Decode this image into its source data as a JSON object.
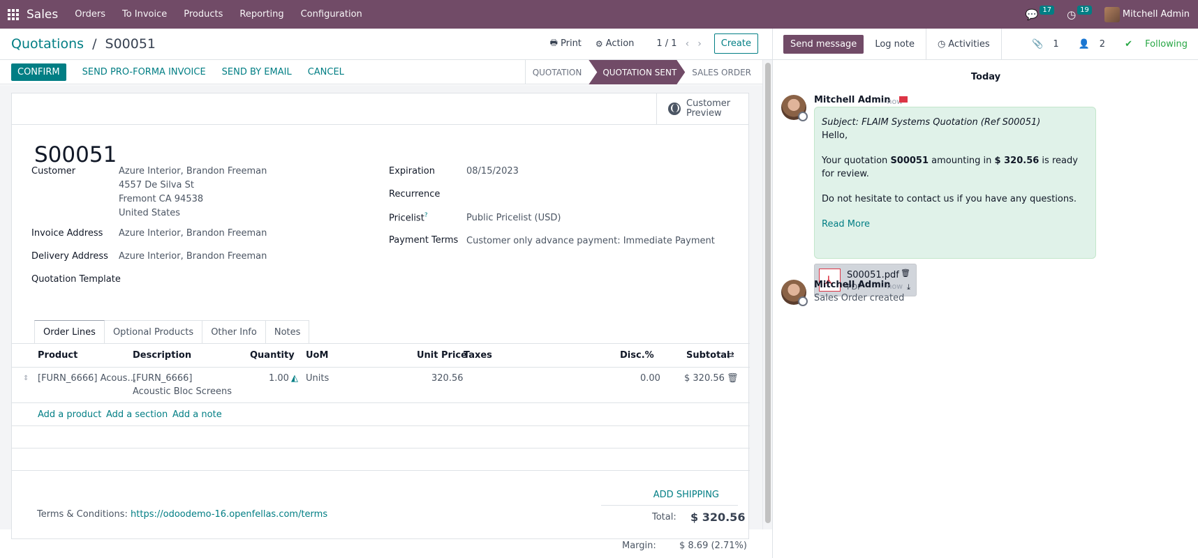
{
  "navbar": {
    "app": "Sales",
    "menu": [
      "Orders",
      "To Invoice",
      "Products",
      "Reporting",
      "Configuration"
    ],
    "messages_count": "17",
    "activities_count": "19",
    "user": "Mitchell Admin"
  },
  "control": {
    "breadcrumb_parent": "Quotations",
    "separator": "/",
    "breadcrumb_current": "S00051",
    "print": "Print",
    "action": "Action",
    "pager": "1 / 1",
    "create": "Create"
  },
  "statusbar": {
    "confirm": "CONFIRM",
    "proforma": "SEND PRO-FORMA INVOICE",
    "email": "SEND BY EMAIL",
    "cancel": "CANCEL",
    "stages": [
      "QUOTATION",
      "QUOTATION SENT",
      "SALES ORDER"
    ],
    "active_stage": "QUOTATION SENT"
  },
  "sheet": {
    "preview_line1": "Customer",
    "preview_line2": "Preview",
    "title": "S00051",
    "customer_label": "Customer",
    "customer_lines": [
      "Azure Interior, Brandon Freeman",
      "4557 De Silva St",
      "Fremont CA 94538",
      "United States"
    ],
    "invoice_label": "Invoice Address",
    "invoice_value": "Azure Interior, Brandon Freeman",
    "delivery_label": "Delivery Address",
    "delivery_value": "Azure Interior, Brandon Freeman",
    "template_label": "Quotation Template",
    "expiration_label": "Expiration",
    "expiration_value": "08/15/2023",
    "recurrence_label": "Recurrence",
    "pricelist_label": "Pricelist",
    "pricelist_help": "?",
    "pricelist_value": "Public Pricelist (USD)",
    "payment_label": "Payment Terms",
    "payment_value": "Customer only advance payment: Immediate Payment"
  },
  "tabs": [
    "Order Lines",
    "Optional Products",
    "Other Info",
    "Notes"
  ],
  "order_lines": {
    "headers": {
      "product": "Product",
      "description": "Description",
      "quantity": "Quantity",
      "uom": "UoM",
      "unit_price": "Unit Price",
      "taxes": "Taxes",
      "discount": "Disc.%",
      "subtotal": "Subtotal"
    },
    "row": {
      "product": "[FURN_6666] Acous…",
      "description_1": "[FURN_6666]",
      "description_2": "Acoustic Bloc Screens",
      "quantity": "1.00",
      "uom": "Units",
      "unit_price": "320.56",
      "discount": "0.00",
      "subtotal": "$ 320.56"
    },
    "add_product": "Add a product",
    "add_section": "Add a section",
    "add_note": "Add a note"
  },
  "footer": {
    "terms_label": "Terms & Conditions:",
    "terms_link": "https://odoodemo-16.openfellas.com/terms",
    "add_shipping": "ADD SHIPPING",
    "total_label": "Total:",
    "total_value": "$ 320.56",
    "margin_label": "Margin:",
    "margin_value": "$ 8.69 (2.71%)"
  },
  "chatter": {
    "send_message": "Send message",
    "log_note": "Log note",
    "activities": "Activities",
    "attachments": "1",
    "followers": "2",
    "following": "Following",
    "today": "Today",
    "messages": [
      {
        "author": "Mitchell Admin",
        "when": "- now",
        "subject": "Subject: FLAIM Systems Quotation (Ref S00051)",
        "hello": "Hello,",
        "body_pre": "Your quotation ",
        "body_ref": "S00051",
        "body_mid": " amounting in ",
        "body_amount": "$ 320.56",
        "body_post": " is ready for review.",
        "contact": "Do not hesitate to contact us if you have any questions.",
        "read_more": "Read More",
        "attachment_name": "S00051.pdf",
        "attachment_type": "PDF"
      },
      {
        "author": "Mitchell Admin",
        "when": "- now",
        "text": "Sales Order created"
      }
    ]
  }
}
